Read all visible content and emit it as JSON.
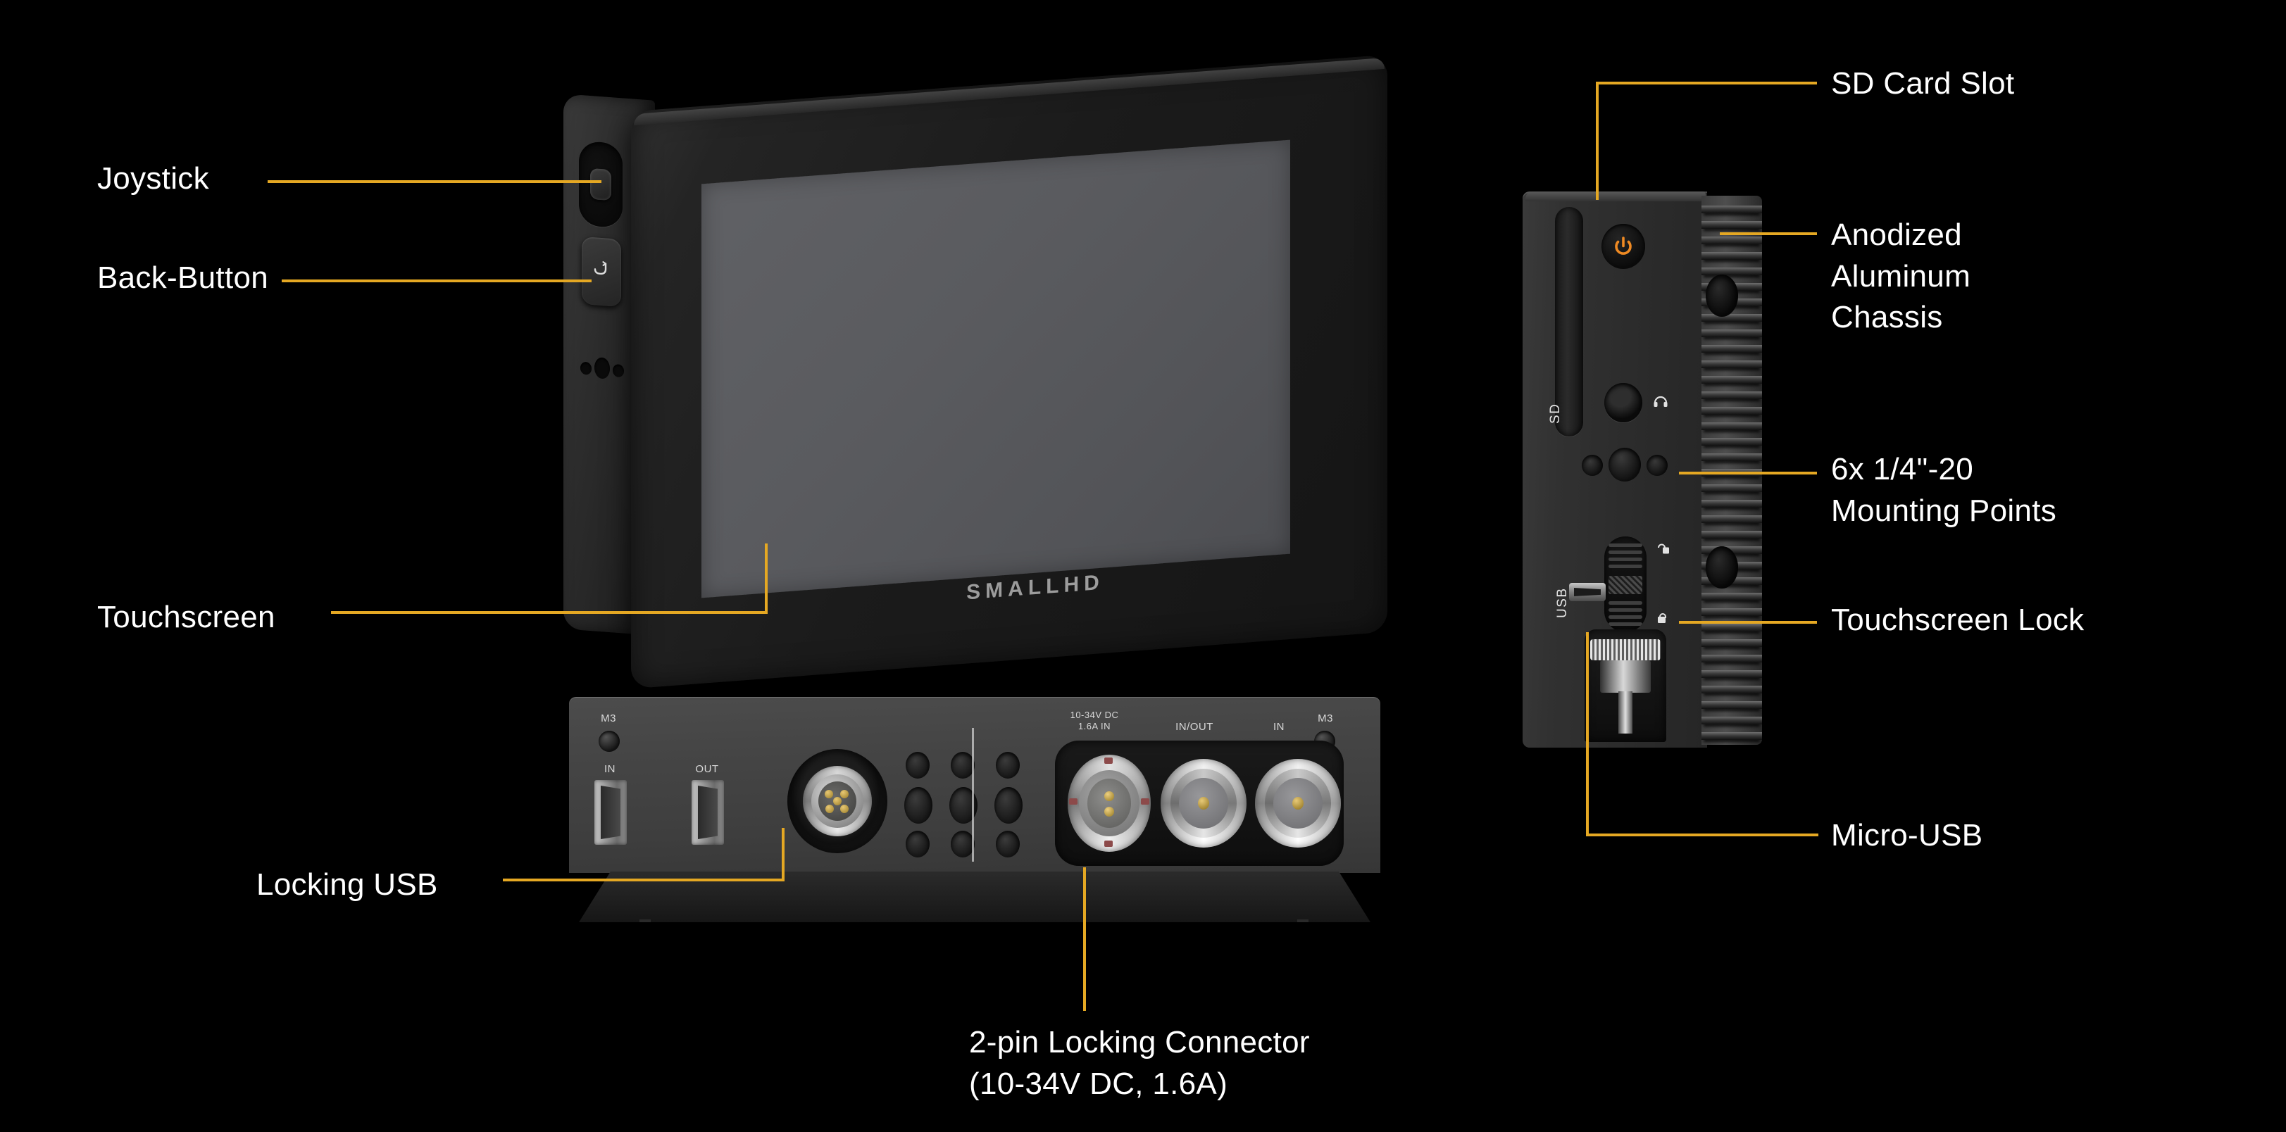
{
  "page": {
    "background": "#000000",
    "accent_color": "#e5a823",
    "text_color": "#ffffff"
  },
  "callouts": {
    "joystick": "Joystick",
    "back_button": "Back-Button",
    "touchscreen": "Touchscreen",
    "locking_usb": "Locking USB",
    "power_connector": "2-pin Locking Connector\n(10-34V DC, 1.6A)",
    "sd_card_slot": "SD Card Slot",
    "anodized_chassis": "Anodized\nAluminum\nChassis",
    "mounting_points": "6x 1/4\"-20\nMounting Points",
    "touchscreen_lock": "Touchscreen Lock",
    "micro_usb": "Micro-USB"
  },
  "front_view": {
    "brand_logo": "SMALLHD",
    "screen_color": "#58595c",
    "body_color": "#1b1b1b"
  },
  "io_panel": {
    "m3_left": "M3",
    "m3_right": "M3",
    "hdmi_in": "IN",
    "hdmi_out": "OUT",
    "power_spec": "10-34V DC\n1.6A IN",
    "sdi_in_out": "IN/OUT",
    "sdi_in": "IN"
  },
  "side_view": {
    "sd_text": "SD",
    "usb_text": "USB",
    "power_icon": "power-icon",
    "headphone_icon": "headphone-jack-icon",
    "lock_icon": "lock-closed-icon",
    "unlock_icon": "lock-open-icon",
    "power_button_color": "#ef8a23"
  }
}
